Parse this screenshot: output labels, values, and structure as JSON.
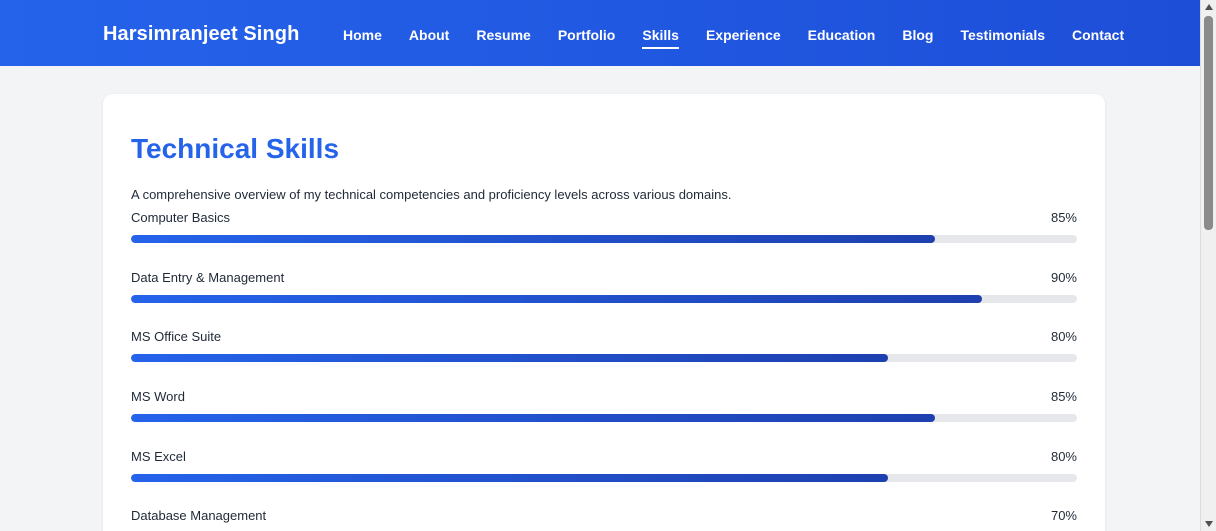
{
  "header": {
    "brand": "Harsimranjeet Singh",
    "nav": [
      {
        "label": "Home",
        "active": false
      },
      {
        "label": "About",
        "active": false
      },
      {
        "label": "Resume",
        "active": false
      },
      {
        "label": "Portfolio",
        "active": false
      },
      {
        "label": "Skills",
        "active": true
      },
      {
        "label": "Experience",
        "active": false
      },
      {
        "label": "Education",
        "active": false
      },
      {
        "label": "Blog",
        "active": false
      },
      {
        "label": "Testimonials",
        "active": false
      },
      {
        "label": "Contact",
        "active": false
      }
    ]
  },
  "colors": {
    "accent": "#2563eb",
    "accent_dark": "#1e40af",
    "track": "#e5e7eb"
  },
  "main": {
    "title": "Technical Skills",
    "description": "A comprehensive overview of my technical competencies and proficiency levels across various domains.",
    "skills": [
      {
        "name": "Computer Basics",
        "percent_label": "85%",
        "level": 85
      },
      {
        "name": "Data Entry & Management",
        "percent_label": "90%",
        "level": 90
      },
      {
        "name": "MS Office Suite",
        "percent_label": "80%",
        "level": 80
      },
      {
        "name": "MS Word",
        "percent_label": "85%",
        "level": 85
      },
      {
        "name": "MS Excel",
        "percent_label": "80%",
        "level": 80
      },
      {
        "name": "Database Management",
        "percent_label": "70%",
        "level": 70
      }
    ]
  }
}
